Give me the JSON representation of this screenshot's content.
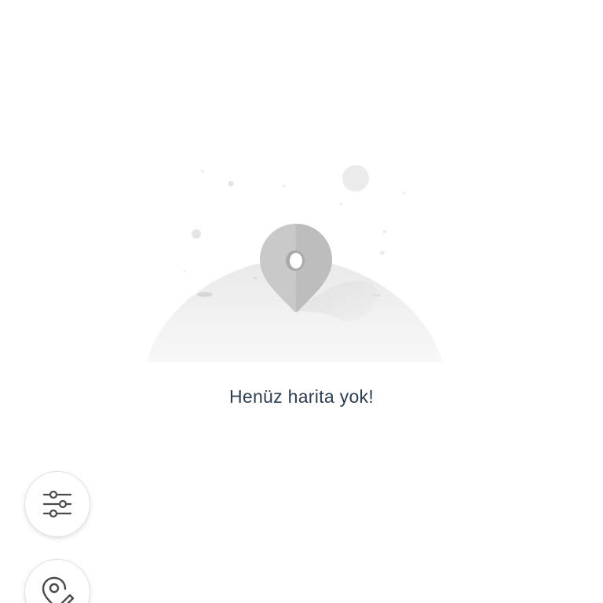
{
  "empty_state": {
    "message": "Henüz harita yok!",
    "illustration_icon": "map-pin-on-moon-illustration"
  },
  "floating_actions": [
    {
      "icon": "sliders-filter-icon"
    },
    {
      "icon": "map-pin-edit-icon"
    }
  ],
  "colors": {
    "background": "#ffffff",
    "text": "#2c3e50",
    "pin": "#c9c9c9",
    "icon_stroke": "#4a4a4a"
  }
}
